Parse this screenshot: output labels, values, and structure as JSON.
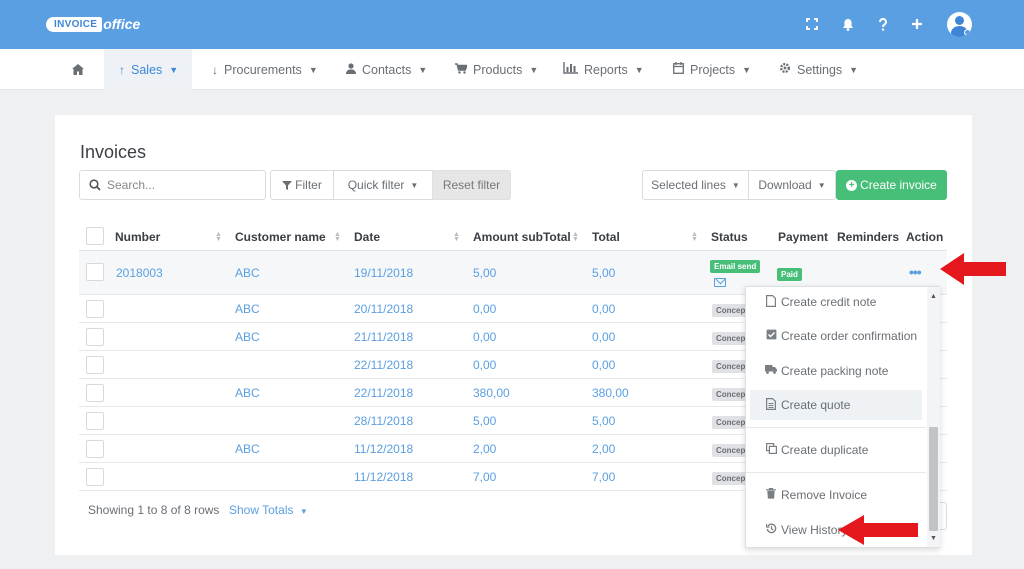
{
  "app": {
    "logo_invoice": "INVOICE",
    "logo_office": "office"
  },
  "topbar": {
    "icons": [
      "fullscreen-icon",
      "bell-icon",
      "help-icon",
      "plus-icon",
      "user-avatar"
    ]
  },
  "nav": {
    "items": [
      {
        "icon": "home-icon",
        "label": ""
      },
      {
        "icon": "arrow-up-icon",
        "label": "Sales"
      },
      {
        "icon": "arrow-down-icon",
        "label": "Procurements"
      },
      {
        "icon": "user-icon",
        "label": "Contacts"
      },
      {
        "icon": "cart-icon",
        "label": "Products"
      },
      {
        "icon": "chart-icon",
        "label": "Reports"
      },
      {
        "icon": "calendar-icon",
        "label": "Projects"
      },
      {
        "icon": "gear-icon",
        "label": "Settings"
      }
    ]
  },
  "page": {
    "title": "Invoices"
  },
  "toolbar": {
    "search_placeholder": "Search...",
    "filter_label": "Filter",
    "quick_filter_label": "Quick filter",
    "reset_filter_label": "Reset filter",
    "selected_lines_label": "Selected lines",
    "download_label": "Download",
    "create_invoice_label": "Create invoice"
  },
  "table": {
    "headers": {
      "number": "Number",
      "customer": "Customer name",
      "date": "Date",
      "amount": "Amount subTotal",
      "total": "Total",
      "status": "Status",
      "payment": "Payment",
      "reminders": "Reminders",
      "action": "Action"
    },
    "rows": [
      {
        "number": "2018003",
        "customer": "ABC",
        "date": "19/11/2018",
        "amount": "5,00",
        "total": "5,00",
        "status": "Email send",
        "payment": "Paid"
      },
      {
        "number": "",
        "customer": "ABC",
        "date": "20/11/2018",
        "amount": "0,00",
        "total": "0,00",
        "status": "Concep",
        "payment": ""
      },
      {
        "number": "",
        "customer": "ABC",
        "date": "21/11/2018",
        "amount": "0,00",
        "total": "0,00",
        "status": "Concep",
        "payment": ""
      },
      {
        "number": "",
        "customer": "",
        "date": "22/11/2018",
        "amount": "0,00",
        "total": "0,00",
        "status": "Concep",
        "payment": ""
      },
      {
        "number": "",
        "customer": "ABC",
        "date": "22/11/2018",
        "amount": "380,00",
        "total": "380,00",
        "status": "Concep",
        "payment": ""
      },
      {
        "number": "",
        "customer": "",
        "date": "28/11/2018",
        "amount": "5,00",
        "total": "5,00",
        "status": "Concep",
        "payment": ""
      },
      {
        "number": "",
        "customer": "ABC",
        "date": "11/12/2018",
        "amount": "2,00",
        "total": "2,00",
        "status": "Concep",
        "payment": ""
      },
      {
        "number": "",
        "customer": "",
        "date": "11/12/2018",
        "amount": "7,00",
        "total": "7,00",
        "status": "Concep",
        "payment": ""
      }
    ]
  },
  "footer": {
    "showing": "Showing 1 to 8 of 8 rows",
    "show_totals": "Show Totals"
  },
  "action_menu": {
    "items": [
      {
        "icon": "file-icon",
        "label": "Create credit note"
      },
      {
        "icon": "checkbox-icon",
        "label": "Create order confirmation"
      },
      {
        "icon": "truck-icon",
        "label": "Create packing note"
      },
      {
        "icon": "document-icon",
        "label": "Create quote"
      },
      {
        "icon": "copy-icon",
        "label": "Create duplicate"
      },
      {
        "icon": "trash-icon",
        "label": "Remove Invoice"
      },
      {
        "icon": "history-icon",
        "label": "View History"
      }
    ]
  },
  "colors": {
    "topbar": "#5b9fe3",
    "accent": "#5a9fe0",
    "green": "#47bf79",
    "annotation_arrow": "#e3171c"
  }
}
